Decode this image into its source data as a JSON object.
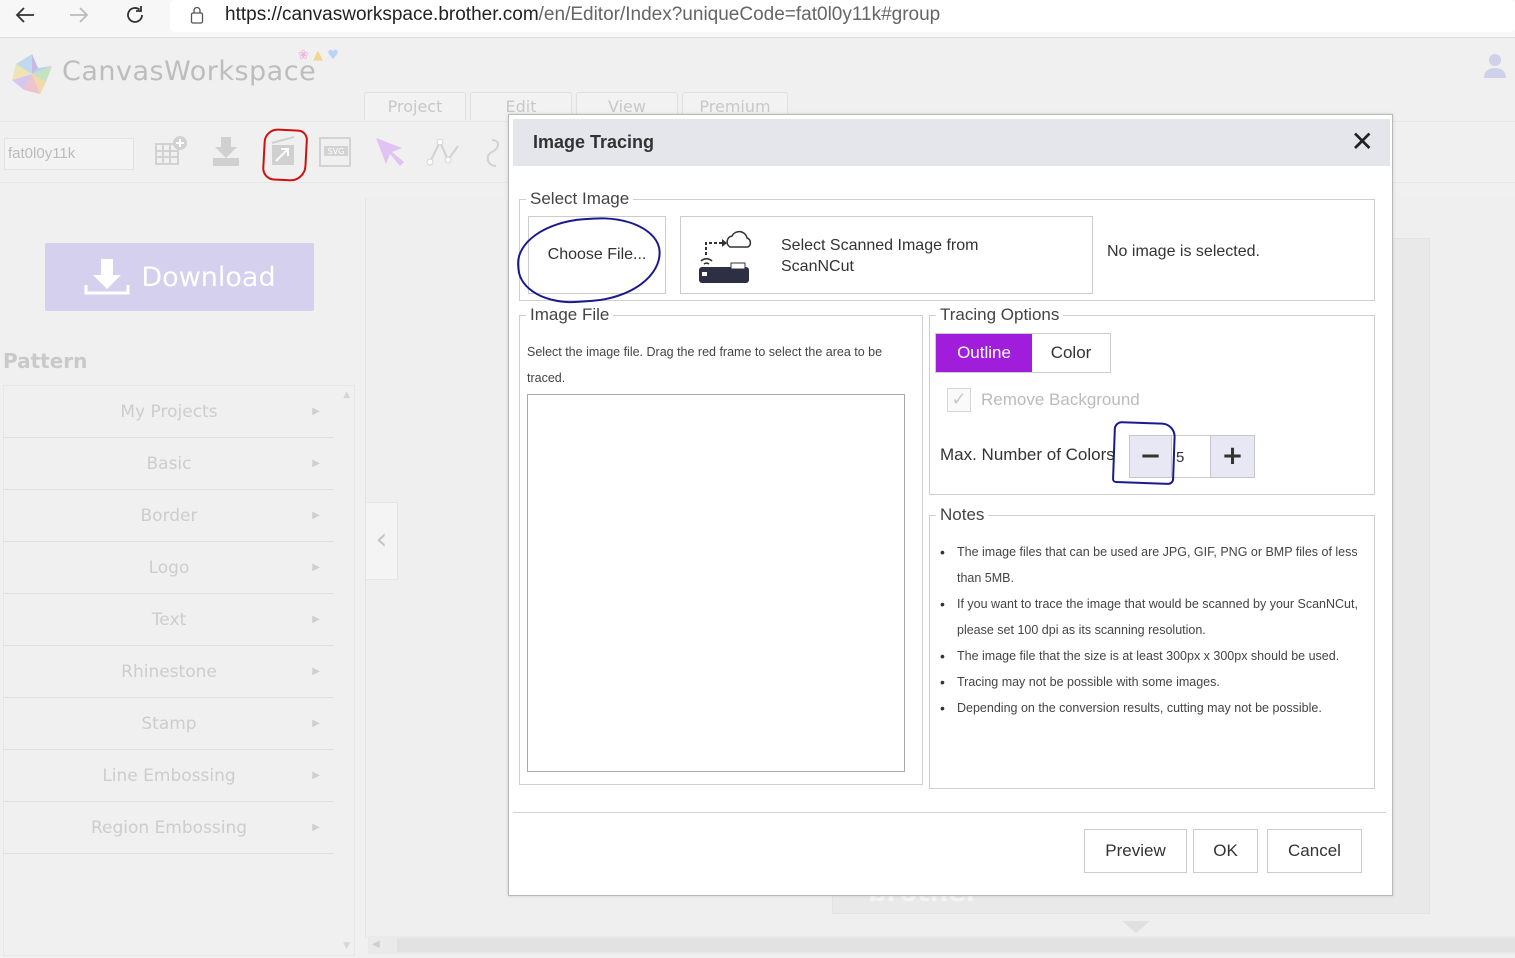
{
  "browser": {
    "back_icon": "arrow-left-icon",
    "forward_icon": "arrow-right-icon",
    "reload_icon": "reload-icon",
    "lock_icon": "lock-icon",
    "url_host": "https://canvasworkspace.brother.com",
    "url_path": "/en/Editor/Index?uniqueCode=fat0l0y11k#group"
  },
  "app": {
    "brand": "CanvasWorkspace",
    "menu_tabs": [
      "Project",
      "Edit",
      "View",
      "Premium"
    ],
    "project_code": "fat0l0y11k",
    "toolbar_icons": [
      "add-grid-icon",
      "import-icon",
      "image-tracing-icon",
      "svg-icon",
      "select-arrow-icon",
      "node-edit-icon",
      "draw-icon"
    ],
    "download_label": "Download",
    "pattern_title": "Pattern",
    "pattern_items": [
      "My Projects",
      "Basic",
      "Border",
      "Logo",
      "Text",
      "Rhinestone",
      "Stamp",
      "Line Embossing",
      "Region Embossing"
    ],
    "collapse_glyph": "‹",
    "mat_label": "brother",
    "accent_color": "#a01ddc"
  },
  "dialog": {
    "title": "Image Tracing",
    "close_glyph": "✕",
    "select_image": {
      "legend": "Select Image",
      "choose_file": "Choose File...",
      "scan_label": "Select Scanned Image from ScanNCut",
      "status": "No image is selected."
    },
    "image_file": {
      "legend": "Image File",
      "description": "Select the image file. Drag the red frame to select the area to be traced."
    },
    "tracing_options": {
      "legend": "Tracing Options",
      "modes": [
        "Outline",
        "Color"
      ],
      "selected_mode": "Outline",
      "remove_background_label": "Remove Background",
      "remove_background_checked": true,
      "remove_background_enabled": false,
      "max_colors_label": "Max. Number of Colors",
      "max_colors_value": "5",
      "minus_glyph": "−",
      "plus_glyph": "+"
    },
    "notes": {
      "legend": "Notes",
      "items": [
        "The image files that can be used are JPG, GIF, PNG or BMP files of less than 5MB.",
        "If you want to trace the image that would be scanned by your ScanNCut, please set 100 dpi as its scanning resolution.",
        "The image file that the size is at least 300px x 300px should be used.",
        "Tracing may not be possible with some images.",
        "Depending on the conversion results, cutting may not be possible."
      ]
    },
    "buttons": {
      "preview": "Preview",
      "ok": "OK",
      "cancel": "Cancel"
    }
  }
}
